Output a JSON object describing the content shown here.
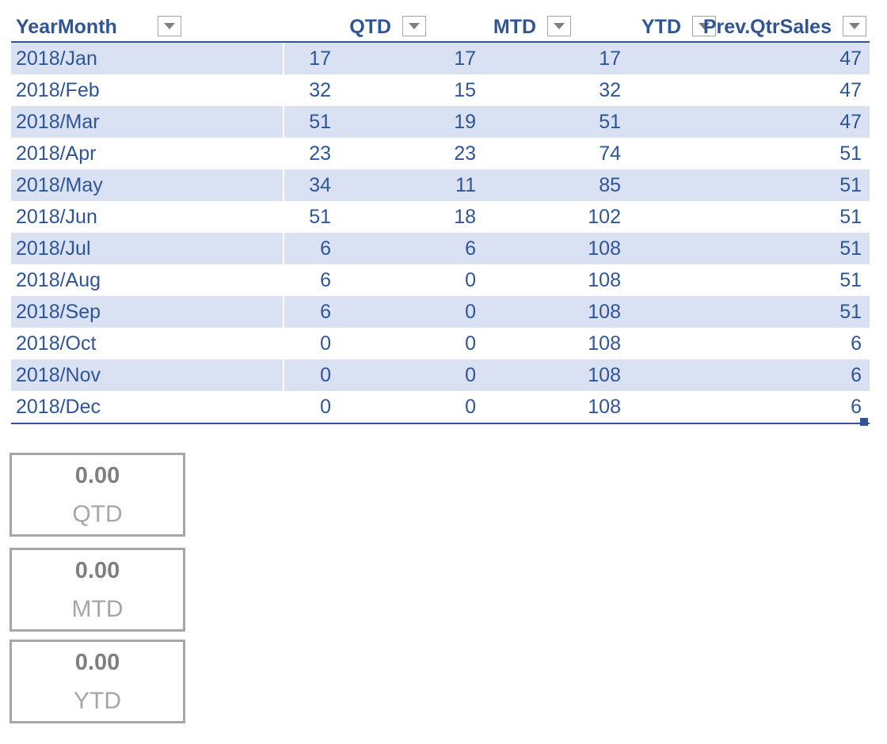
{
  "table": {
    "headers": [
      "YearMonth",
      "QTD",
      "MTD",
      "YTD",
      "Prev.QtrSales"
    ],
    "rows": [
      [
        "2018/Jan",
        "17",
        "17",
        "17",
        "47"
      ],
      [
        "2018/Feb",
        "32",
        "15",
        "32",
        "47"
      ],
      [
        "2018/Mar",
        "51",
        "19",
        "51",
        "47"
      ],
      [
        "2018/Apr",
        "23",
        "23",
        "74",
        "51"
      ],
      [
        "2018/May",
        "34",
        "11",
        "85",
        "51"
      ],
      [
        "2018/Jun",
        "51",
        "18",
        "102",
        "51"
      ],
      [
        "2018/Jul",
        "6",
        "6",
        "108",
        "51"
      ],
      [
        "2018/Aug",
        "6",
        "0",
        "108",
        "51"
      ],
      [
        "2018/Sep",
        "6",
        "0",
        "108",
        "51"
      ],
      [
        "2018/Oct",
        "0",
        "0",
        "108",
        "6"
      ],
      [
        "2018/Nov",
        "0",
        "0",
        "108",
        "6"
      ],
      [
        "2018/Dec",
        "0",
        "0",
        "108",
        "6"
      ]
    ]
  },
  "cards": [
    {
      "value": "0.00",
      "label": "QTD"
    },
    {
      "value": "0.00",
      "label": "MTD"
    },
    {
      "value": "0.00",
      "label": "YTD"
    }
  ],
  "colors": {
    "header_text": "#2f5597",
    "band": "#d9e1f2",
    "card_border": "#a6a6a6"
  },
  "icons": {
    "filter_dropdown": "filter-dropdown-icon"
  }
}
